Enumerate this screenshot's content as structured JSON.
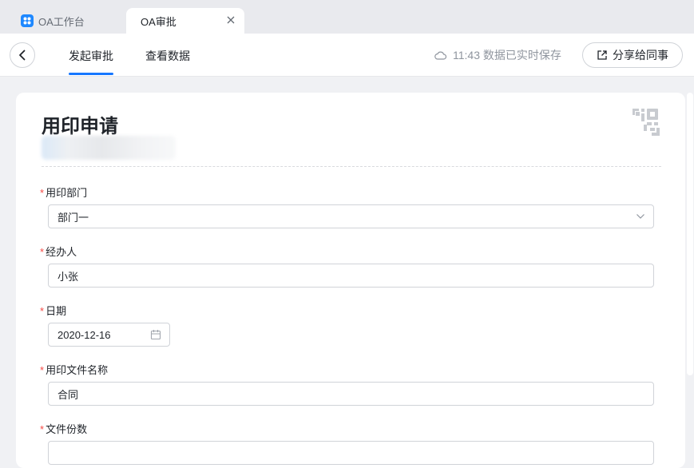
{
  "tabs": [
    {
      "label": "OA工作台",
      "active": false
    },
    {
      "label": "OA审批",
      "active": true
    }
  ],
  "toolbar": {
    "nav": [
      {
        "label": "发起审批",
        "active": true
      },
      {
        "label": "查看数据",
        "active": false
      }
    ],
    "save_status": "11:43 数据已实时保存",
    "share_label": "分享给同事"
  },
  "form": {
    "title": "用印申请",
    "fields": [
      {
        "label": "用印部门",
        "required": true,
        "type": "select",
        "value": "部门一"
      },
      {
        "label": "经办人",
        "required": true,
        "type": "text",
        "value": "小张"
      },
      {
        "label": "日期",
        "required": true,
        "type": "date",
        "value": "2020-12-16"
      },
      {
        "label": "用印文件名称",
        "required": true,
        "type": "text",
        "value": "合同"
      },
      {
        "label": "文件份数",
        "required": true,
        "type": "number",
        "value": ""
      }
    ]
  },
  "colors": {
    "accent": "#1677ff",
    "required": "#f54a45",
    "page_bg": "#f0f1f4"
  },
  "icons": [
    "app-grid-icon",
    "close-icon",
    "back-arrow-icon",
    "cloud-icon",
    "share-icon",
    "qr-code-icon",
    "chevron-down-icon",
    "calendar-icon"
  ]
}
